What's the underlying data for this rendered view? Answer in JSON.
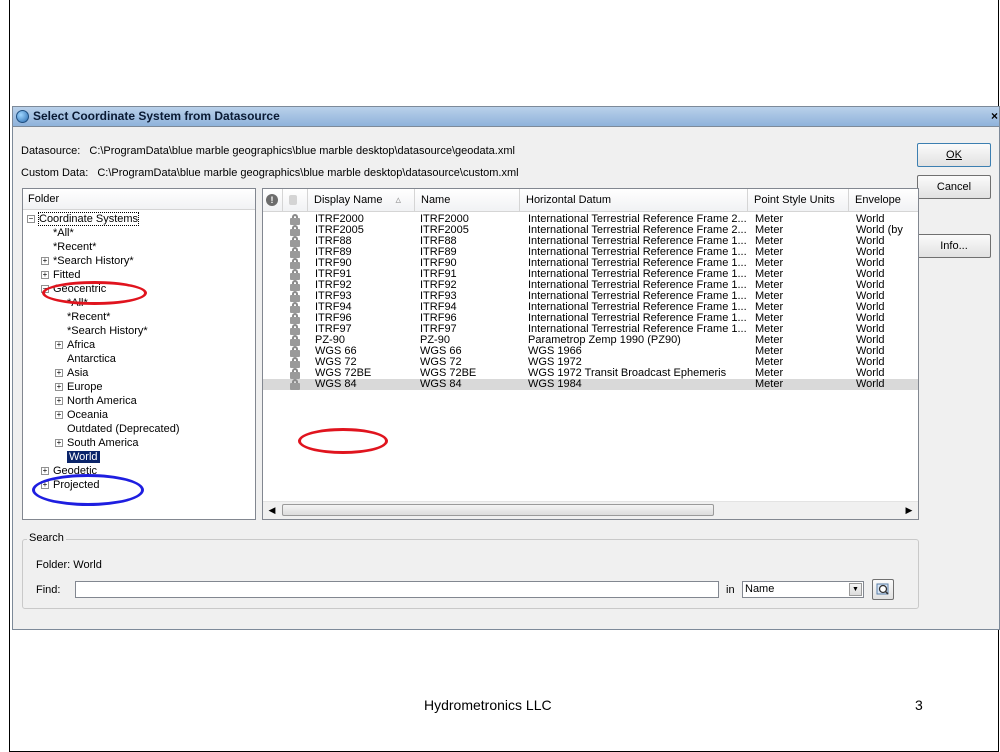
{
  "dialog": {
    "title": "Select Coordinate System from Datasource",
    "close": "×",
    "datasource_label": "Datasource:",
    "datasource_path": "C:\\ProgramData\\blue marble geographics\\blue marble desktop\\datasource\\geodata.xml",
    "custom_label": "Custom Data:",
    "custom_path": "C:\\ProgramData\\blue marble geographics\\blue marble desktop\\datasource\\custom.xml"
  },
  "buttons": {
    "ok": "OK",
    "cancel": "Cancel",
    "info": "Info..."
  },
  "folder": {
    "header": "Folder",
    "nodes": [
      {
        "label": "Coordinate Systems",
        "expander": "−"
      },
      {
        "label": "*All*",
        "expander": ""
      },
      {
        "label": "*Recent*",
        "expander": ""
      },
      {
        "label": "*Search History*",
        "expander": "+"
      },
      {
        "label": "Fitted",
        "expander": "+"
      },
      {
        "label": "Geocentric",
        "expander": "−"
      },
      {
        "label": "*All*",
        "expander": ""
      },
      {
        "label": "*Recent*",
        "expander": ""
      },
      {
        "label": "*Search History*",
        "expander": ""
      },
      {
        "label": "Africa",
        "expander": "+"
      },
      {
        "label": "Antarctica",
        "expander": ""
      },
      {
        "label": "Asia",
        "expander": "+"
      },
      {
        "label": "Europe",
        "expander": "+"
      },
      {
        "label": "North America",
        "expander": "+"
      },
      {
        "label": "Oceania",
        "expander": "+"
      },
      {
        "label": "Outdated (Deprecated)",
        "expander": ""
      },
      {
        "label": "South America",
        "expander": "+"
      },
      {
        "label": "World",
        "expander": ""
      },
      {
        "label": "Geodetic",
        "expander": "+"
      },
      {
        "label": "Projected",
        "expander": "+"
      }
    ],
    "selected": "World"
  },
  "grid": {
    "columns": [
      "",
      "",
      "Display Name",
      "Name",
      "Horizontal Datum",
      "Point Style Units",
      "Envelope"
    ],
    "sort_indicator": "▵",
    "rows": [
      [
        "ITRF2000",
        "ITRF2000",
        "International Terrestrial Reference Frame 2...",
        "Meter",
        "World"
      ],
      [
        "ITRF2005",
        "ITRF2005",
        "International Terrestrial Reference Frame 2...",
        "Meter",
        "World (by"
      ],
      [
        "ITRF88",
        "ITRF88",
        "International Terrestrial Reference Frame 1...",
        "Meter",
        "World"
      ],
      [
        "ITRF89",
        "ITRF89",
        "International Terrestrial Reference Frame 1...",
        "Meter",
        "World"
      ],
      [
        "ITRF90",
        "ITRF90",
        "International Terrestrial Reference Frame 1...",
        "Meter",
        "World"
      ],
      [
        "ITRF91",
        "ITRF91",
        "International Terrestrial Reference Frame 1...",
        "Meter",
        "World"
      ],
      [
        "ITRF92",
        "ITRF92",
        "International Terrestrial Reference Frame 1...",
        "Meter",
        "World"
      ],
      [
        "ITRF93",
        "ITRF93",
        "International Terrestrial Reference Frame 1...",
        "Meter",
        "World"
      ],
      [
        "ITRF94",
        "ITRF94",
        "International Terrestrial Reference Frame 1...",
        "Meter",
        "World"
      ],
      [
        "ITRF96",
        "ITRF96",
        "International Terrestrial Reference Frame 1...",
        "Meter",
        "World"
      ],
      [
        "ITRF97",
        "ITRF97",
        "International Terrestrial Reference Frame 1...",
        "Meter",
        "World"
      ],
      [
        "PZ-90",
        "PZ-90",
        "Parametrop Zemp 1990 (PZ90)",
        "Meter",
        "World"
      ],
      [
        "WGS 66",
        "WGS 66",
        "WGS 1966",
        "Meter",
        "World"
      ],
      [
        "WGS 72",
        "WGS 72",
        "WGS 1972",
        "Meter",
        "World"
      ],
      [
        "WGS 72BE",
        "WGS 72BE",
        "WGS 1972 Transit Broadcast Ephemeris",
        "Meter",
        "World"
      ],
      [
        "WGS 84",
        "WGS 84",
        "WGS 1984",
        "Meter",
        "World"
      ]
    ],
    "selected_index": 15
  },
  "search": {
    "legend": "Search",
    "folder_text": "Folder:  World",
    "find_label": "Find:",
    "find_value": "",
    "in_label": "in",
    "in_value": "Name"
  },
  "footer": {
    "company": "Hydrometronics LLC",
    "page_number": "3"
  },
  "colors": {
    "highlight_red": "#e0141e",
    "highlight_blue": "#1e1ee0",
    "selection": "#0a246a"
  },
  "icons": [
    "window-app-icon",
    "close-icon",
    "tree-expander-icon",
    "lock-icon",
    "info-column-icon",
    "sort-arrow-icon",
    "dropdown-arrow-icon",
    "find-search-icon"
  ]
}
